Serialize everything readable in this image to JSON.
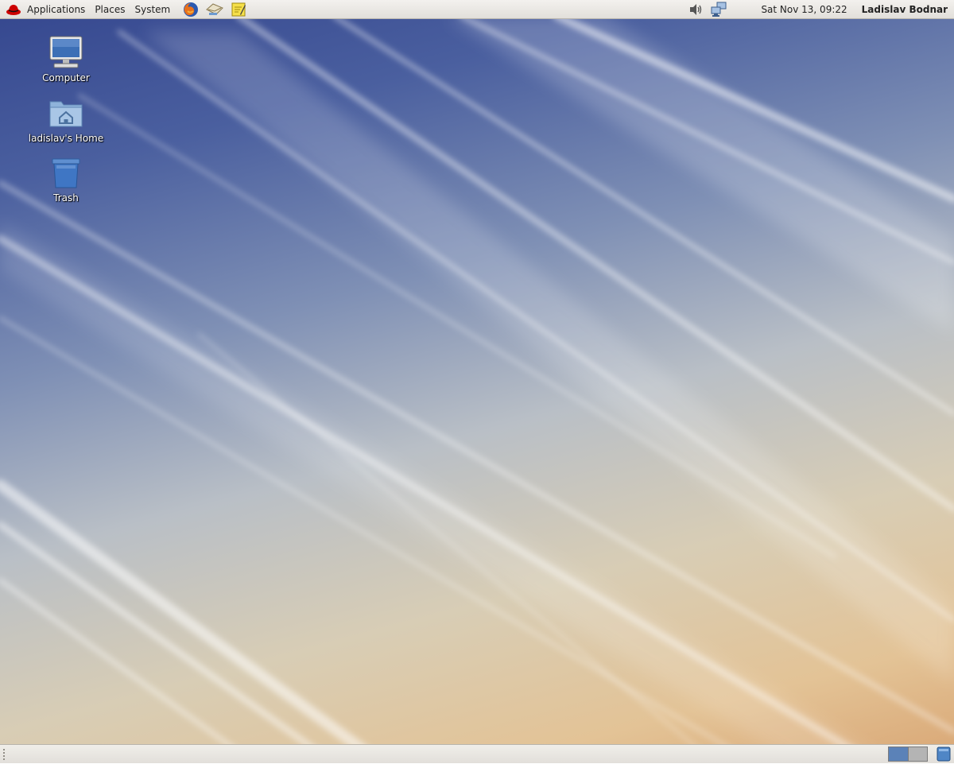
{
  "top_panel": {
    "menus": [
      "Applications",
      "Places",
      "System"
    ],
    "launchers": [
      "firefox-icon",
      "mail-icon",
      "notes-icon"
    ],
    "tray": [
      "volume-icon",
      "network-icon"
    ],
    "clock": "Sat Nov 13, 09:22",
    "user": "Ladislav Bodnar"
  },
  "desktop": {
    "icons": [
      {
        "label": "Computer",
        "icon": "computer-icon"
      },
      {
        "label": "ladislav's Home",
        "icon": "home-folder-icon"
      },
      {
        "label": "Trash",
        "icon": "trash-icon"
      }
    ]
  },
  "bottom_panel": {
    "workspaces": 2,
    "active_workspace": 1
  },
  "colors": {
    "panel": "#e8e6e2",
    "workspace_active": "#5b82b8",
    "workspace_inactive": "#b4b4b4"
  }
}
